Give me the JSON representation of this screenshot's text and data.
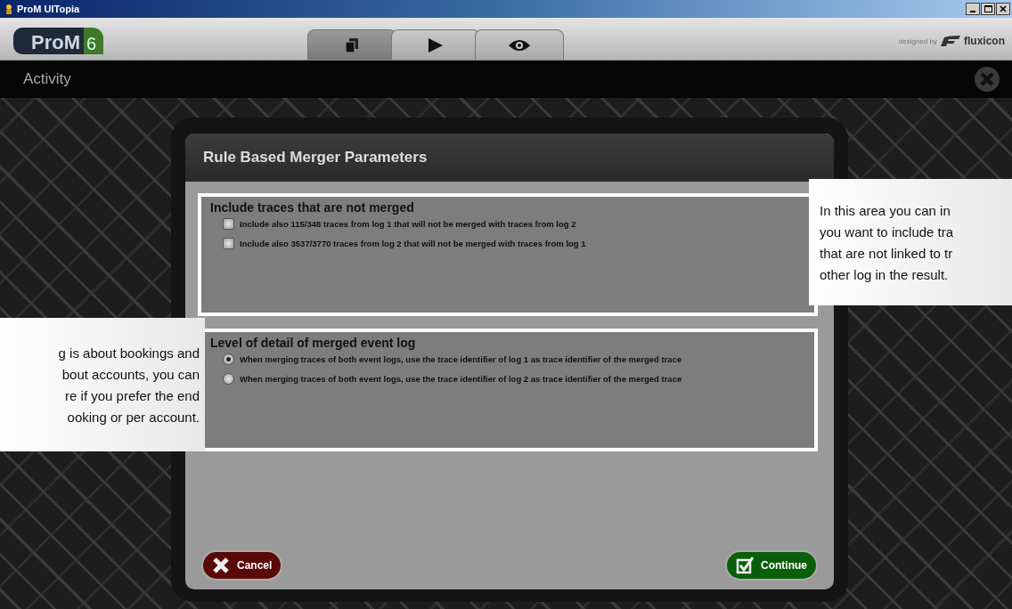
{
  "window": {
    "title": "ProM UITopia"
  },
  "header": {
    "logo_text": "ProM",
    "logo_version": "6",
    "credit": "designed by",
    "brand": "fluxicon",
    "tabs": [
      {
        "kind": "workspace",
        "selected": true
      },
      {
        "kind": "actions",
        "selected": false
      },
      {
        "kind": "views",
        "selected": false
      }
    ]
  },
  "activity_bar": {
    "title": "Activity"
  },
  "dialog": {
    "title": "Rule Based Merger Parameters",
    "sections": [
      {
        "kind": "checkbox",
        "title": "Include traces that are not merged",
        "options": [
          {
            "label": "Include also 115/348 traces from log 1 that will not be merged with traces from log 2",
            "checked": false
          },
          {
            "label": "Include also 3537/3770 traces from log 2 that will not be merged with traces from log 1",
            "checked": false
          }
        ]
      },
      {
        "kind": "radio",
        "title": "Level of detail of merged event log",
        "options": [
          {
            "label": "When merging traces of both event logs, use the trace identifier of log 1 as trace identifier of the merged trace",
            "selected": true
          },
          {
            "label": "When merging traces of both event logs, use the trace identifier of log 2 as trace identifier of the merged trace",
            "selected": false
          }
        ]
      }
    ],
    "cancel": "Cancel",
    "continue": "Continue"
  },
  "callouts": [
    {
      "kind": "right",
      "lines": [
        "In this area you can in",
        "you want to include tra",
        "that are not linked to tr",
        "other log in the result."
      ]
    },
    {
      "kind": "left",
      "lines": [
        "g is about bookings and",
        "bout accounts, you can",
        "re if you prefer the end",
        "ooking or per account."
      ]
    }
  ]
}
